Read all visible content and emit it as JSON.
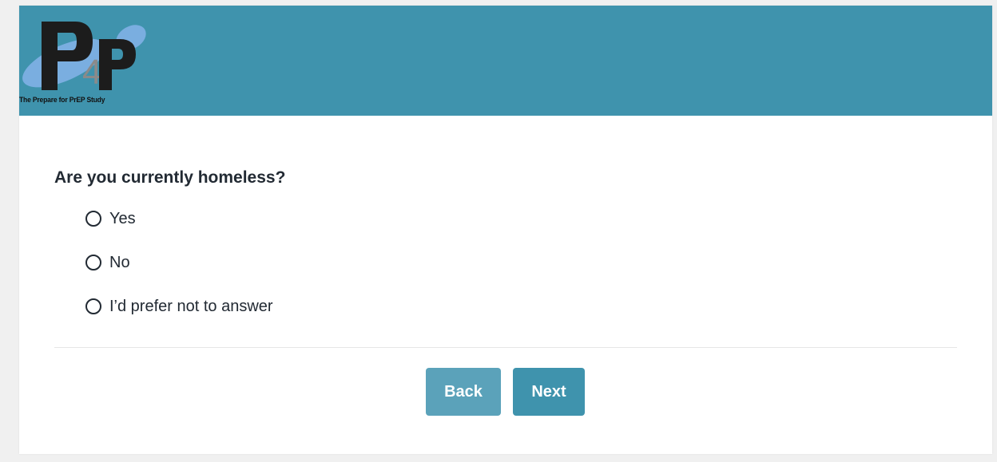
{
  "header": {
    "logo_caption": "The Prepare for PrEP Study",
    "logo_letters": "P4P"
  },
  "question": {
    "text": "Are you currently homeless?",
    "options": [
      {
        "label": "Yes",
        "selected": false
      },
      {
        "label": "No",
        "selected": false
      },
      {
        "label": "I’d prefer not to answer",
        "selected": false
      }
    ]
  },
  "navigation": {
    "back_label": "Back",
    "next_label": "Next"
  },
  "colors": {
    "banner": "#3f93ad",
    "back_button": "#5ba2ba",
    "next_button": "#3f93ad",
    "text": "#222a33"
  }
}
